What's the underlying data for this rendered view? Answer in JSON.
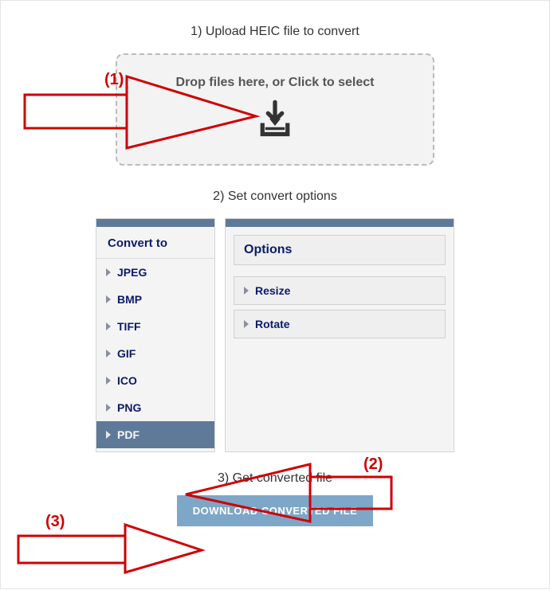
{
  "step1": {
    "title": "1) Upload HEIC file to convert",
    "drop_text": "Drop files here, or Click to select"
  },
  "step2": {
    "title": "2) Set convert options",
    "convert_to_label": "Convert to",
    "formats": [
      "JPEG",
      "BMP",
      "TIFF",
      "GIF",
      "ICO",
      "PNG",
      "PDF"
    ],
    "selected_format": "PDF",
    "options_label": "Options",
    "option_items": [
      "Resize",
      "Rotate"
    ]
  },
  "step3": {
    "title": "3) Get converted file",
    "download_label": "DOWNLOAD CONVERTED FILE"
  },
  "annotation": {
    "labels": [
      "(1)",
      "(2)",
      "(3)"
    ],
    "color": "#d00000"
  }
}
